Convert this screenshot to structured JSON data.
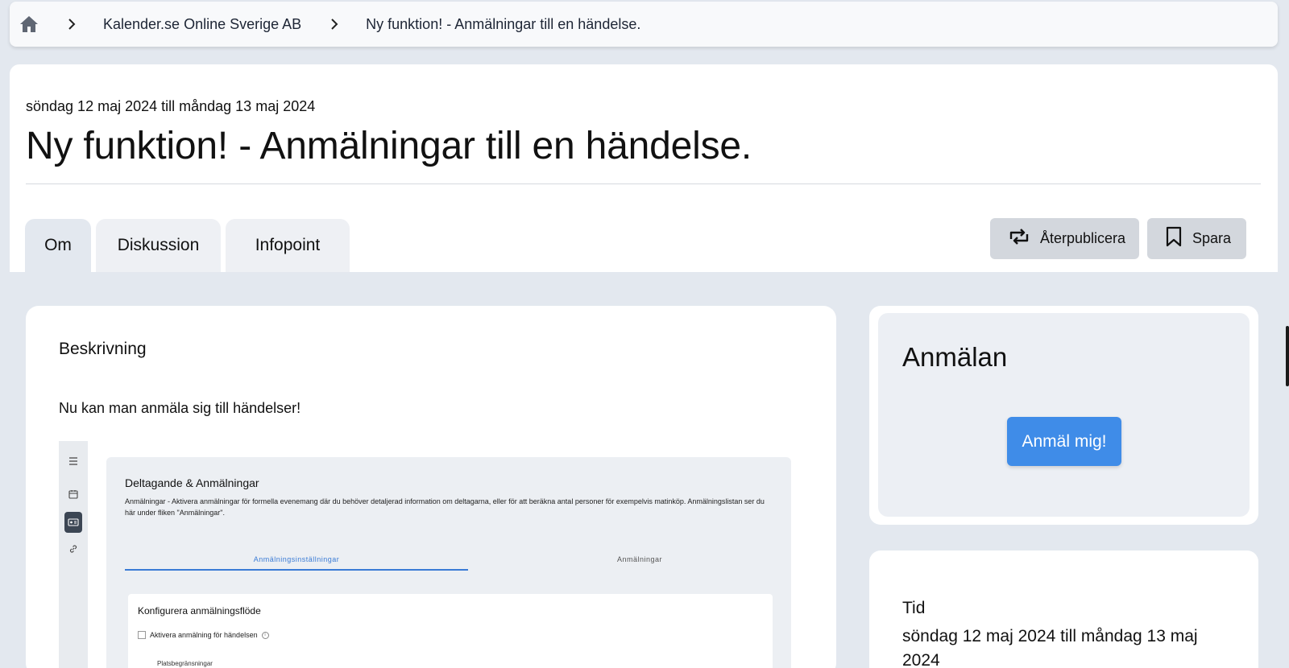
{
  "breadcrumb": {
    "items": [
      "Kalender.se Online Sverige AB",
      "Ny funktion! - Anmälningar till en händelse."
    ]
  },
  "event": {
    "date_range": "söndag 12 maj 2024 till måndag 13 maj 2024",
    "title": "Ny funktion! - Anmälningar till en händelse."
  },
  "tabs": [
    {
      "label": "Om"
    },
    {
      "label": "Diskussion"
    },
    {
      "label": "Infopoint"
    }
  ],
  "actions": {
    "republish_label": "Återpublicera",
    "save_label": "Spara"
  },
  "description": {
    "heading": "Beskrivning",
    "text": "Nu kan man anmäla sig till händelser!"
  },
  "embedded": {
    "title": "Deltagande & Anmälningar",
    "description": "Anmälningar - Aktivera anmälningar för formella evenemang där du behöver detaljerad information om deltagarna, eller för att beräkna antal personer för exempelvis matinköp. Anmälningslistan ser du här under fliken \"Anmälningar\".",
    "tabs": [
      "Anmälningsinställningar",
      "Anmälningar"
    ],
    "config_title": "Konfigurera anmälningsflöde",
    "checkbox_label": "Aktivera anmälning för händelsen",
    "sub_label": "Platsbegränsningar"
  },
  "signup": {
    "title": "Anmälan",
    "button_label": "Anmäl mig!"
  },
  "time": {
    "label": "Tid",
    "value": "söndag 12 maj 2024 till måndag 13 maj 2024"
  },
  "colors": {
    "accent": "#3f8ce8",
    "page_bg": "#e3e8ef",
    "button_gray": "#d3d7dd"
  }
}
